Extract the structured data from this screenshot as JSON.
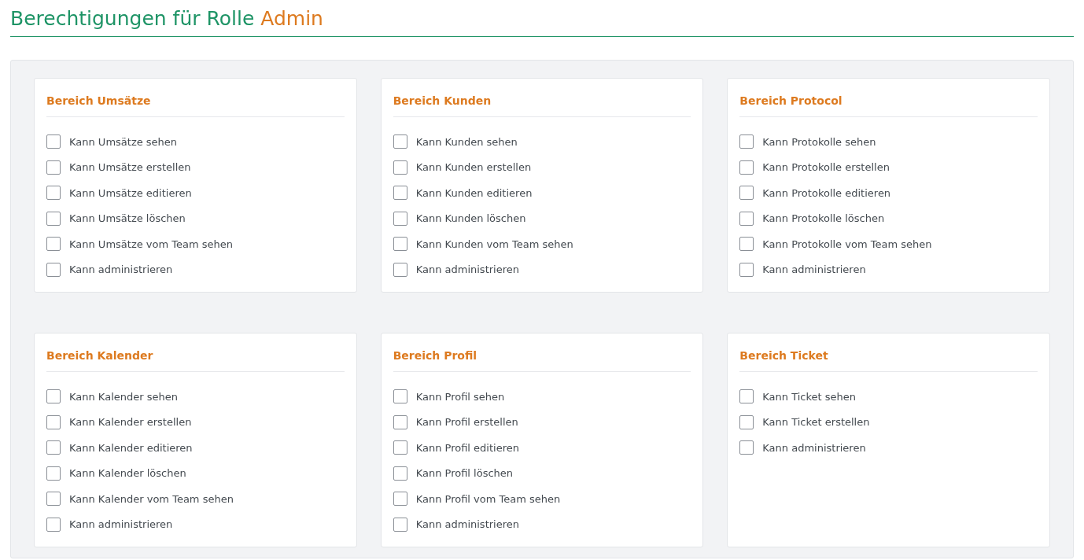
{
  "title": {
    "text": "Berechtigungen für Rolle",
    "role": "Admin"
  },
  "sections": [
    {
      "title": "Bereich Umsätze",
      "permissions": [
        {
          "label": "Kann Umsätze sehen",
          "checked": false
        },
        {
          "label": "Kann Umsätze erstellen",
          "checked": false
        },
        {
          "label": "Kann Umsätze editieren",
          "checked": false
        },
        {
          "label": "Kann Umsätze löschen",
          "checked": false
        },
        {
          "label": "Kann Umsätze vom Team sehen",
          "checked": false
        },
        {
          "label": "Kann administrieren",
          "checked": false
        }
      ]
    },
    {
      "title": "Bereich Kunden",
      "permissions": [
        {
          "label": "Kann Kunden sehen",
          "checked": false
        },
        {
          "label": "Kann Kunden erstellen",
          "checked": false
        },
        {
          "label": "Kann Kunden editieren",
          "checked": false
        },
        {
          "label": "Kann Kunden löschen",
          "checked": false
        },
        {
          "label": "Kann Kunden vom Team sehen",
          "checked": false
        },
        {
          "label": "Kann administrieren",
          "checked": false
        }
      ]
    },
    {
      "title": "Bereich Protocol",
      "permissions": [
        {
          "label": "Kann Protokolle sehen",
          "checked": false
        },
        {
          "label": "Kann Protokolle erstellen",
          "checked": false
        },
        {
          "label": "Kann Protokolle editieren",
          "checked": false
        },
        {
          "label": "Kann Protokolle löschen",
          "checked": false
        },
        {
          "label": "Kann Protokolle vom Team sehen",
          "checked": false
        },
        {
          "label": "Kann administrieren",
          "checked": false
        }
      ]
    },
    {
      "title": "Bereich Kalender",
      "permissions": [
        {
          "label": "Kann Kalender sehen",
          "checked": false
        },
        {
          "label": "Kann Kalender erstellen",
          "checked": false
        },
        {
          "label": "Kann Kalender editieren",
          "checked": false
        },
        {
          "label": "Kann Kalender löschen",
          "checked": false
        },
        {
          "label": "Kann Kalender vom Team sehen",
          "checked": false
        },
        {
          "label": "Kann administrieren",
          "checked": false
        }
      ]
    },
    {
      "title": "Bereich Profil",
      "permissions": [
        {
          "label": "Kann Profil sehen",
          "checked": false
        },
        {
          "label": "Kann Profil erstellen",
          "checked": false
        },
        {
          "label": "Kann Profil editieren",
          "checked": false
        },
        {
          "label": "Kann Profil löschen",
          "checked": false
        },
        {
          "label": "Kann Profil vom Team sehen",
          "checked": false
        },
        {
          "label": "Kann administrieren",
          "checked": false
        }
      ]
    },
    {
      "title": "Bereich Ticket",
      "permissions": [
        {
          "label": "Kann Ticket sehen",
          "checked": false
        },
        {
          "label": "Kann Ticket erstellen",
          "checked": false
        },
        {
          "label": "Kann administrieren",
          "checked": false
        }
      ]
    }
  ]
}
